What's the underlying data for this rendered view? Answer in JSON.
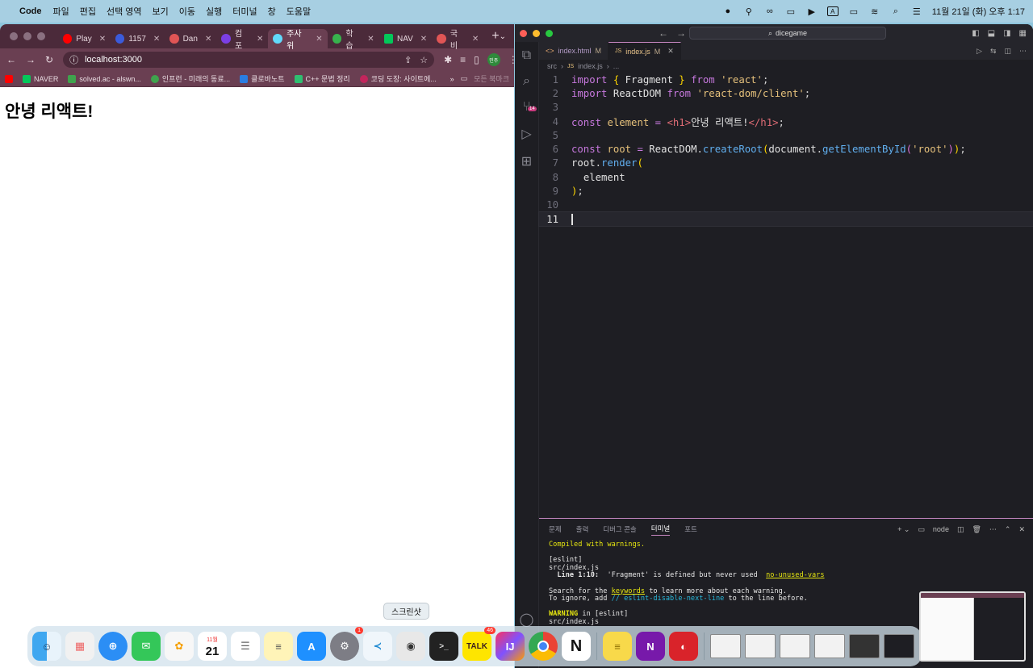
{
  "menubar": {
    "app_name": "Code",
    "menus": [
      "파일",
      "편집",
      "선택 영역",
      "보기",
      "이동",
      "실행",
      "터미널",
      "창",
      "도움말"
    ],
    "datetime": "11월 21일 (화) 오후 1:17",
    "input_source": "A"
  },
  "chrome": {
    "tabs": [
      {
        "label": "Play",
        "color": "#ff0000"
      },
      {
        "label": "1157",
        "color": "#3b5bdb"
      },
      {
        "label": "Dan",
        "color": "#e05555"
      },
      {
        "label": "컴포",
        "color": "#7b3fe4"
      },
      {
        "label": "주사위",
        "color": "#61dafb",
        "active": true
      },
      {
        "label": "학습",
        "color": "#37b24d"
      },
      {
        "label": "NAV",
        "color": "#03c75a"
      },
      {
        "label": "국비",
        "color": "#e05555"
      }
    ],
    "url": "localhost:3000",
    "profile": "민주",
    "bookmarks": [
      {
        "label": "",
        "color": "#ff0000"
      },
      {
        "label": "NAVER",
        "color": "#03c75a"
      },
      {
        "label": "solved.ac - alswn...",
        "color": "#3fa34d"
      },
      {
        "label": "인프런 - 미래의 동료...",
        "color": "#3fa34d"
      },
      {
        "label": "클로바노트",
        "color": "#2a7de1"
      },
      {
        "label": "C++ 문법 정리",
        "color": "#2fbf71"
      },
      {
        "label": "코딩 도장: 사이트에...",
        "color": "#c2255c"
      }
    ],
    "other_bookmarks": "모든 북마크",
    "page_heading": "안녕 리액트!"
  },
  "vscode": {
    "search": "dicegame",
    "tabs": [
      {
        "label": "index.html",
        "status": "M",
        "icon": "<>"
      },
      {
        "label": "index.js",
        "status": "M",
        "icon": "JS",
        "active": true
      }
    ],
    "breadcrumb": [
      "src",
      "index.js",
      "..."
    ],
    "scm_badge": "14",
    "panel_tabs": [
      "문제",
      "출력",
      "디버그 콘솔",
      "터미널",
      "포트"
    ],
    "terminal_name": "node",
    "terminal_lines": {
      "compiled": "Compiled with warnings.",
      "eslint1": "[eslint]",
      "file1": "src/index.js",
      "line_pos": "Line 1:10:",
      "warn_msg": "'Fragment' is defined but never used",
      "rule": "no-unused-vars",
      "search_pre": "Search for the ",
      "keywords": "keywords",
      "search_post": " to learn more about each warning.",
      "ignore_pre": "To ignore, add ",
      "ignore_comment": "// eslint-disable-next-line",
      "ignore_post": " to the line before.",
      "warning": "WARNING",
      "warning_post": " in [eslint]",
      "file2": "src/index.js"
    }
  },
  "dock": {
    "tooltip": "스크린샷",
    "calendar_month": "11월",
    "calendar_day": "21",
    "settings_badge": "1",
    "talk_badge": "46",
    "talk_label": "TALK"
  }
}
